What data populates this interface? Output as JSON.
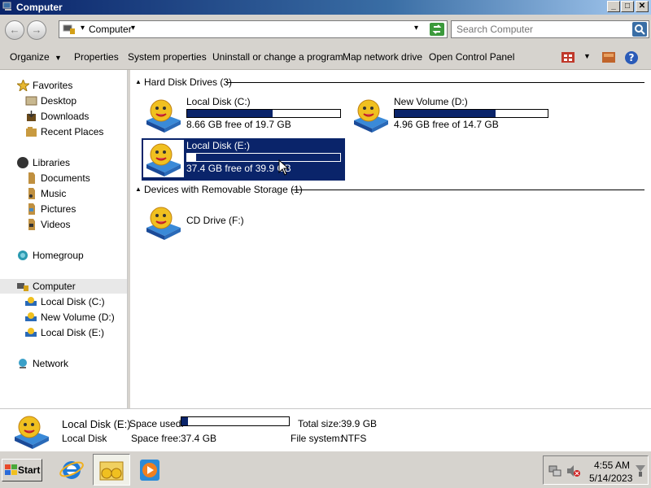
{
  "window": {
    "title": "Computer",
    "min": "_",
    "max": "□",
    "close": "✕"
  },
  "address": {
    "location": "Computer",
    "dropdown_glyph": "▾"
  },
  "search": {
    "placeholder": "Search Computer"
  },
  "toolbar": {
    "organize": "Organize",
    "properties": "Properties",
    "system_properties": "System properties",
    "uninstall": "Uninstall or change a program",
    "map_drive": "Map network drive",
    "control_panel": "Open Control Panel"
  },
  "sidebar": {
    "favorites": "Favorites",
    "desktop": "Desktop",
    "downloads": "Downloads",
    "recent": "Recent Places",
    "libraries": "Libraries",
    "documents": "Documents",
    "music": "Music",
    "pictures": "Pictures",
    "videos": "Videos",
    "homegroup": "Homegroup",
    "computer": "Computer",
    "drive_c": "Local Disk (C:)",
    "drive_d": "New Volume (D:)",
    "drive_e": "Local Disk (E:)",
    "network": "Network"
  },
  "groups": {
    "hdd": "Hard Disk Drives (3)",
    "removable": "Devices with Removable Storage (1)"
  },
  "drives": [
    {
      "label": "Local Disk (C:)",
      "free": "8.66 GB free of 19.7 GB",
      "used_fraction": 0.56
    },
    {
      "label": "New Volume (D:)",
      "free": "4.96 GB free of 14.7 GB",
      "used_fraction": 0.66
    },
    {
      "label": "Local Disk (E:)",
      "free": "37.4 GB free of 39.9 GB",
      "used_fraction": 0.06
    }
  ],
  "cd": {
    "label": "CD Drive (F:)"
  },
  "details": {
    "name": "Local Disk (E:)",
    "type": "Local Disk",
    "space_used_label": "Space used:",
    "space_free_label": "Space free:",
    "space_free": "37.4 GB",
    "total_label": "Total size:",
    "total": "39.9 GB",
    "fs_label": "File system:",
    "fs": "NTFS",
    "used_fraction": 0.06
  },
  "taskbar": {
    "start": "Start",
    "time": "4:55 AM",
    "date": "5/14/2023"
  },
  "colors": {
    "selection": "#0a246a",
    "chrome": "#d6d3ce"
  }
}
